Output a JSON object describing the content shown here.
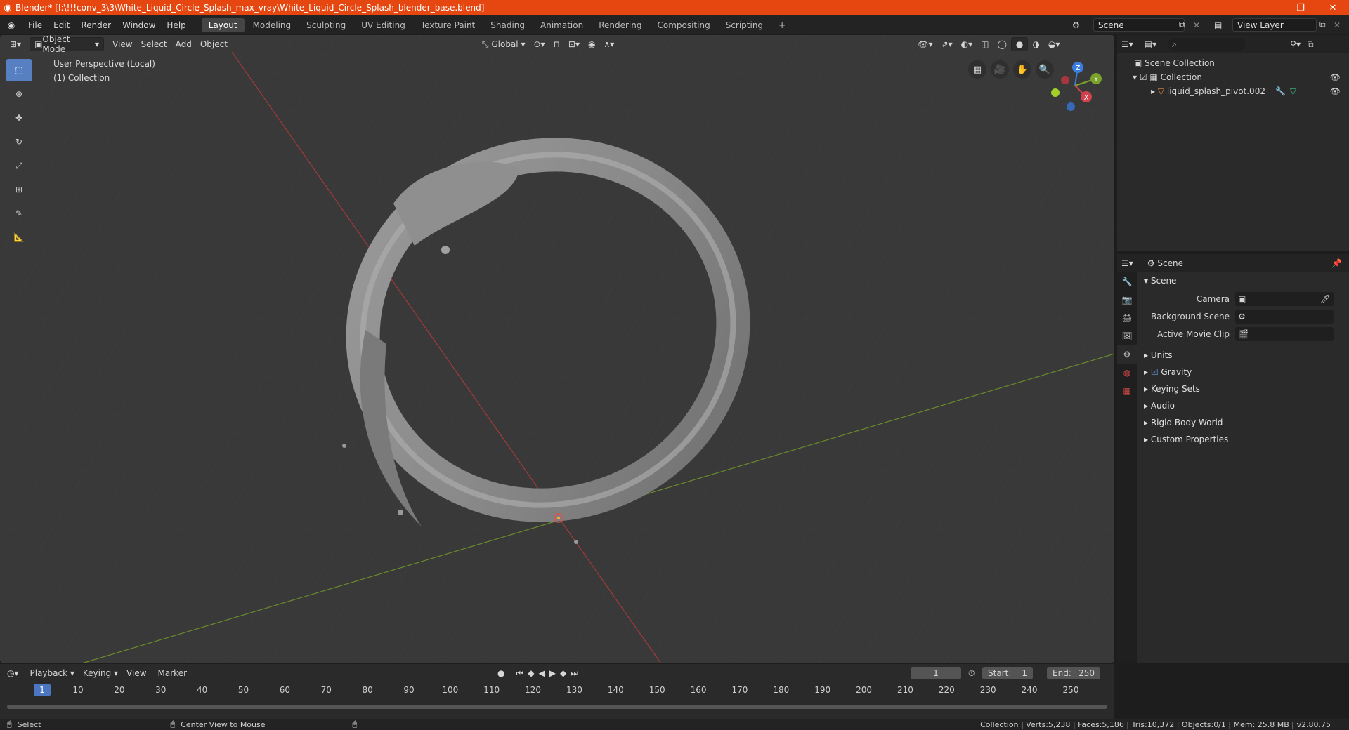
{
  "titlebar": {
    "title": "Blender* [I:\\!!!conv_3\\3\\White_Liquid_Circle_Splash_max_vray\\White_Liquid_Circle_Splash_blender_base.blend]",
    "minimize": "—",
    "maximize": "❐",
    "close": "✕"
  },
  "menu": [
    "File",
    "Edit",
    "Render",
    "Window",
    "Help"
  ],
  "workspaces": [
    "Layout",
    "Modeling",
    "Sculpting",
    "UV Editing",
    "Texture Paint",
    "Shading",
    "Animation",
    "Rendering",
    "Compositing",
    "Scripting"
  ],
  "add_workspace": "+",
  "scene_name": "Scene",
  "view_layer": "View Layer",
  "viewport": {
    "mode": "Object Mode",
    "menus": [
      "View",
      "Select",
      "Add",
      "Object"
    ],
    "transform_orientation": "Global",
    "perspective_label": "User Perspective (Local)",
    "collection_label": "(1) Collection"
  },
  "gizmo": {
    "x": "X",
    "y": "Y",
    "z": "Z"
  },
  "outliner": {
    "search_placeholder": "",
    "scene_collection": "Scene Collection",
    "collection": "Collection",
    "object": "liquid_splash_pivot.002"
  },
  "properties": {
    "context": "Scene",
    "panel": "Scene",
    "camera_label": "Camera",
    "background_scene_label": "Background Scene",
    "active_movie_clip_label": "Active Movie Clip",
    "sections": [
      "Units",
      "Gravity",
      "Keying Sets",
      "Audio",
      "Rigid Body World",
      "Custom Properties"
    ]
  },
  "timeline": {
    "menus": [
      "Playback",
      "Keying",
      "View",
      "Marker"
    ],
    "current_frame": "1",
    "start_label": "Start:",
    "start": "1",
    "end_label": "End:",
    "end": "250",
    "ruler": [
      "1",
      "10",
      "20",
      "30",
      "40",
      "50",
      "60",
      "70",
      "80",
      "90",
      "100",
      "110",
      "120",
      "130",
      "140",
      "150",
      "160",
      "170",
      "180",
      "190",
      "200",
      "210",
      "220",
      "230",
      "240",
      "250"
    ]
  },
  "statusbar": {
    "left_action": "Select",
    "middle_action": "Center View to Mouse",
    "stats": "Collection | Verts:5,238 | Faces:5,186 | Tris:10,372 | Objects:0/1 | Mem: 25.8 MB | v2.80.75"
  }
}
